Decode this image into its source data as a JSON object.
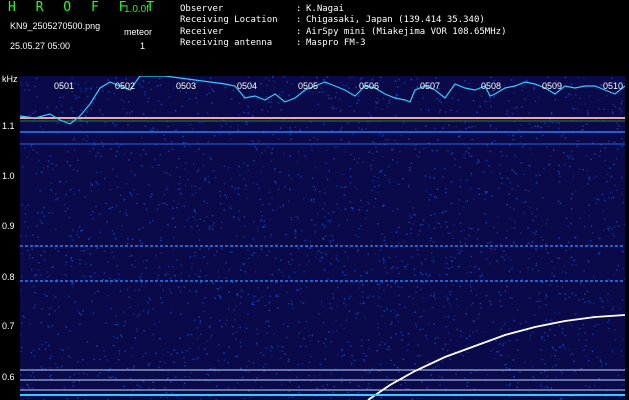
{
  "header": {
    "brand": "H R O F F T",
    "version": "1.0.0f",
    "filename": "KN9_2505270500.png",
    "mode_label": "meteor",
    "mode_value": "1",
    "timestamp": "25.05.27 05:00"
  },
  "station": [
    {
      "label": "Observer",
      "value": "K.Nagai"
    },
    {
      "label": "Receiving Location",
      "value": "Chigasaki, Japan (139.414 35.340)"
    },
    {
      "label": "Receiver",
      "value": "AirSpy mini (Miakejima VOR 108.65MHz)"
    },
    {
      "label": "Receiving antenna",
      "value": "Maspro FM-3"
    }
  ],
  "axes": {
    "y_unit": "kHz",
    "y_ticks": [
      "1.1",
      "1.0",
      "0.9",
      "0.8",
      "0.7",
      "0.6"
    ],
    "x_ticks": [
      "0501",
      "0502",
      "0503",
      "0504",
      "0505",
      "0506",
      "0507",
      "0508",
      "0509",
      "0510"
    ]
  },
  "colors": {
    "background": "#0a0a4a",
    "noise": "#1c4cc8",
    "trace": "#ffffff",
    "level": "#33ccff",
    "carrier": "#ffa0a0"
  }
}
